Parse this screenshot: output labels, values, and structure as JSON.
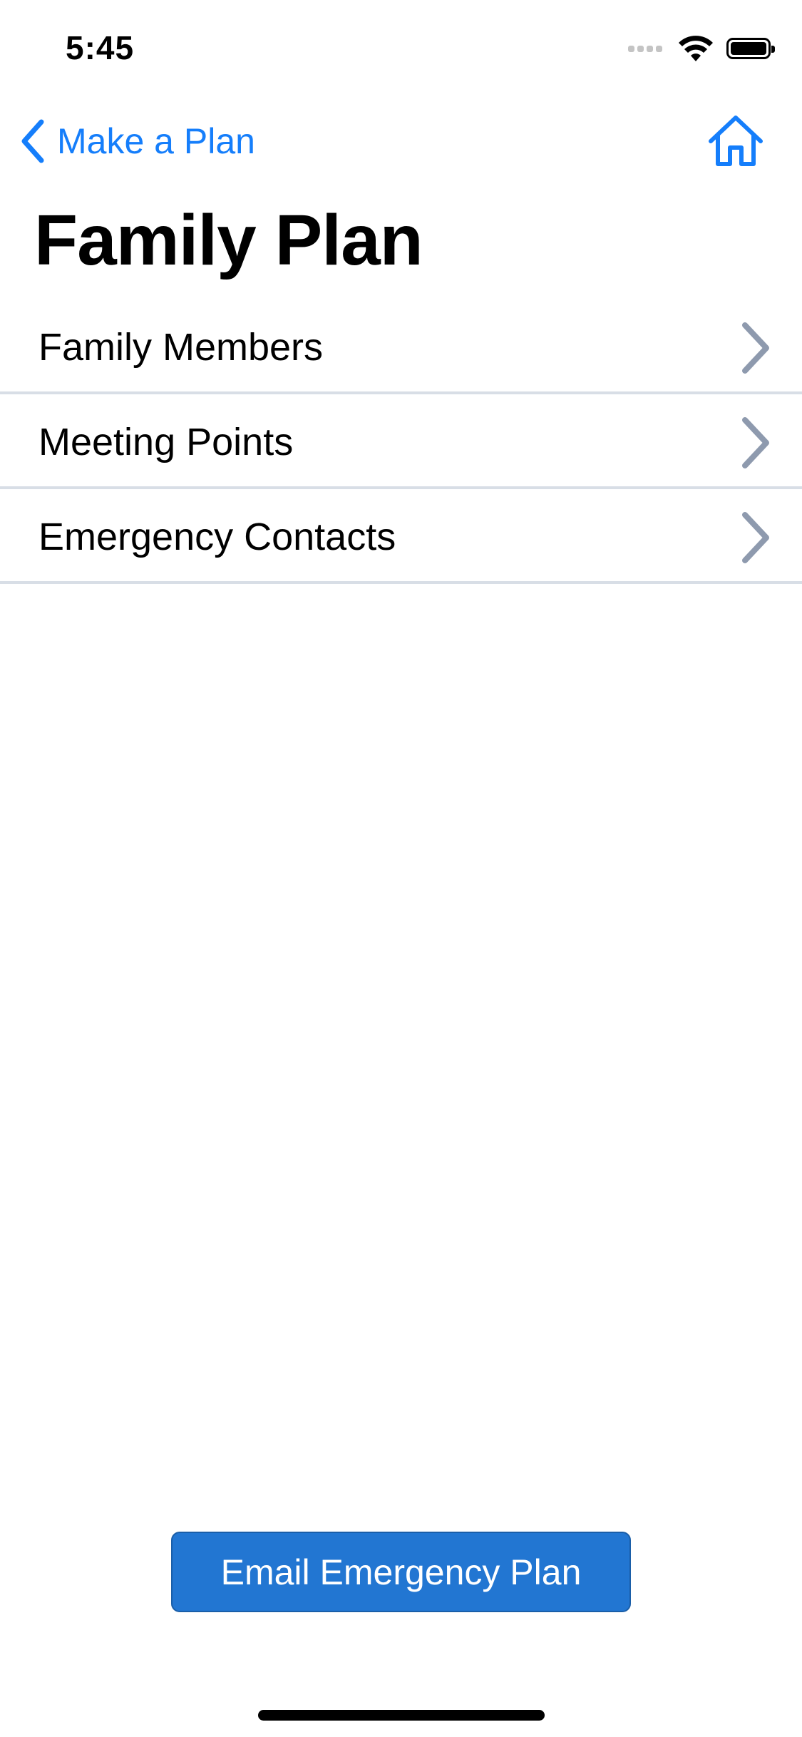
{
  "status_bar": {
    "time": "5:45"
  },
  "nav": {
    "back_label": "Make a Plan",
    "back_icon": "chevron-left-icon",
    "home_icon": "home-icon"
  },
  "page": {
    "title": "Family Plan"
  },
  "menu": {
    "items": [
      {
        "label": "Family Members"
      },
      {
        "label": "Meeting Points"
      },
      {
        "label": "Emergency Contacts"
      }
    ]
  },
  "footer": {
    "email_button_label": "Email Emergency Plan"
  },
  "colors": {
    "accent": "#157efb",
    "button_bg": "#2276d2",
    "chevron": "#8e9aae",
    "divider": "#d8dee6"
  }
}
